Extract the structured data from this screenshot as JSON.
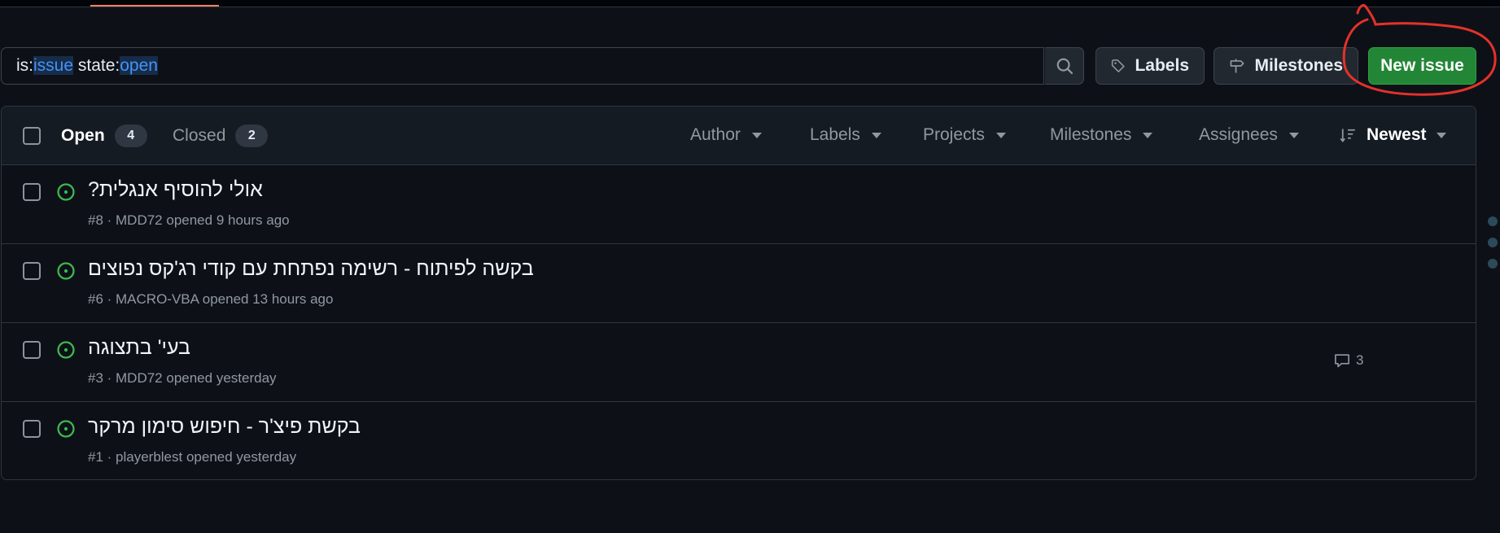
{
  "search": {
    "parts": [
      {
        "text": "is:",
        "hl": false
      },
      {
        "text": "issue",
        "hl": true
      },
      {
        "text": " state:",
        "hl": false
      },
      {
        "text": "open",
        "hl": true
      }
    ]
  },
  "toolbar": {
    "labels_label": "Labels",
    "milestones_label": "Milestones",
    "new_issue_label": "New issue"
  },
  "header": {
    "open_label": "Open",
    "open_count": "4",
    "closed_label": "Closed",
    "closed_count": "2",
    "filters": [
      "Author",
      "Labels",
      "Projects",
      "Milestones",
      "Assignees"
    ],
    "sort_label": "Newest"
  },
  "issues": [
    {
      "title": "אולי להוסיף אנגלית?",
      "meta": "#8 · MDD72 opened 9 hours ago",
      "comments": ""
    },
    {
      "title": "בקשה לפיתוח - רשימה נפתחת עם קודי רג'קס נפוצים",
      "meta": "#6 · MACRO-VBA opened 13 hours ago",
      "comments": ""
    },
    {
      "title": "בעי' בתצוגה",
      "meta": "#3 · MDD72 opened yesterday",
      "comments": "3"
    },
    {
      "title": "בקשת פיצ'ר - חיפוש סימון מרקר",
      "meta": "#1 · playerblest opened yesterday",
      "comments": ""
    }
  ],
  "colors": {
    "background": "#0d1117",
    "accent_green": "#238636",
    "open_icon": "#3fb950",
    "annotation": "#e5312b"
  }
}
